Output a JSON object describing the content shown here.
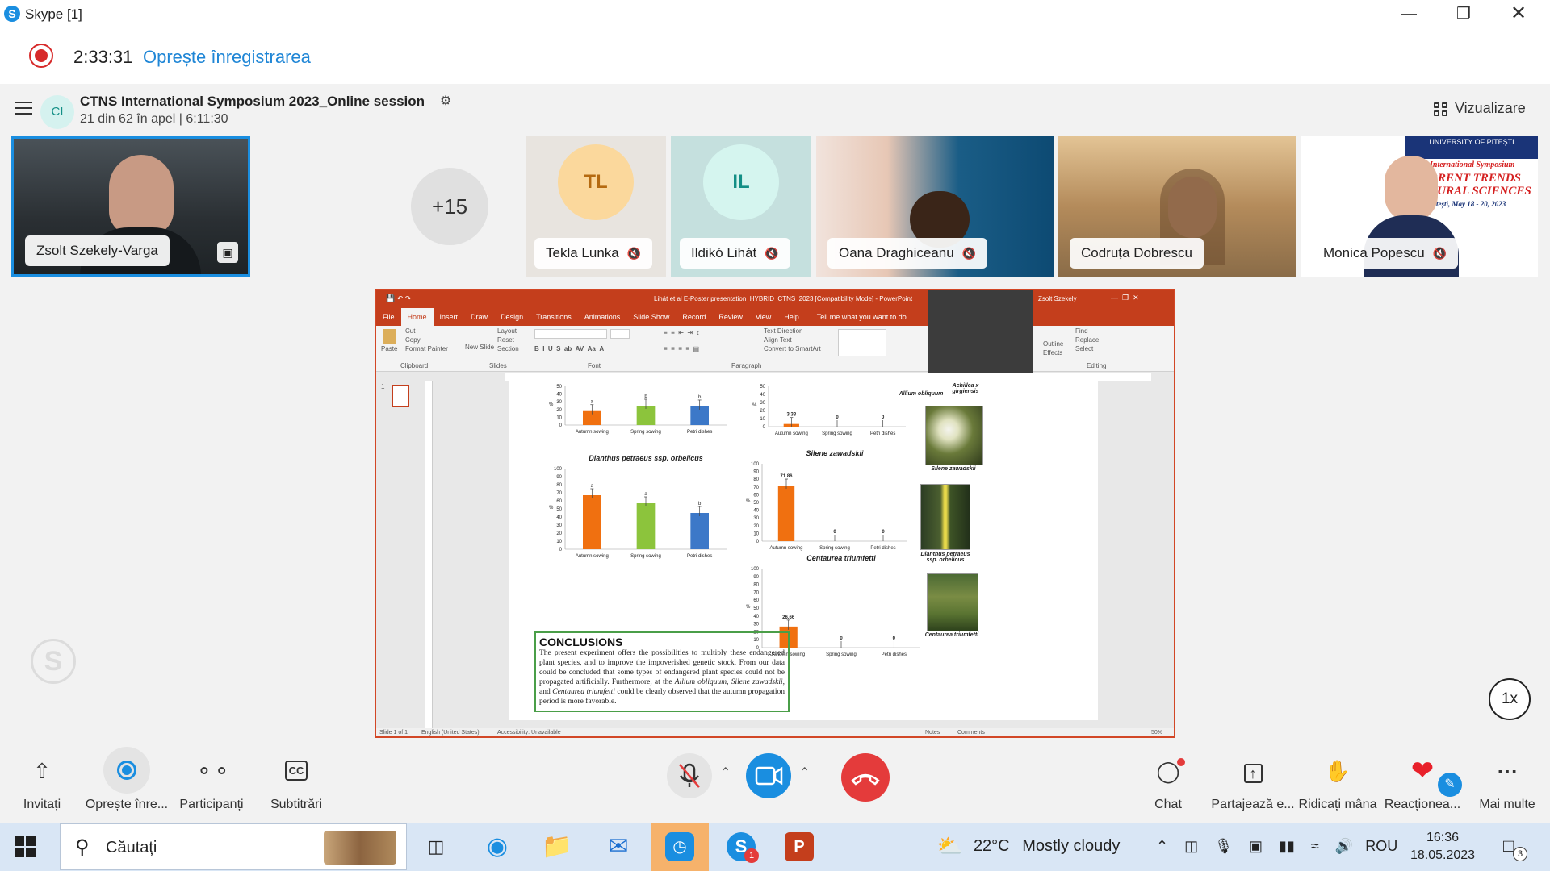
{
  "window": {
    "title": "Skype [1]"
  },
  "recording": {
    "time": "2:33:31",
    "stop_label": "Oprește înregistrarea"
  },
  "call": {
    "avatar_initials": "CI",
    "title": "CTNS International Symposium 2023_Online session",
    "subtitle": "21 din 62 în apel | 6:11:30",
    "view_label": "Vizualizare"
  },
  "participants": {
    "self_name": "Zsolt Szekely-Varga",
    "more_count": "+15",
    "tiles": [
      {
        "name": "Tekla Lunka",
        "initials": "TL"
      },
      {
        "name": "Ildikó Lihát",
        "initials": "IL"
      },
      {
        "name": "Oana Draghiceanu"
      },
      {
        "name": "Codruța Dobrescu"
      },
      {
        "name": "Monica Popescu"
      }
    ],
    "poster_text": [
      "UNIVERSITY OF PITEȘTI",
      "International Symposium",
      "RRENT TRENDS",
      "TURAL SCIENCES",
      "Pitești, May 18 - 20, 2023"
    ]
  },
  "ppt": {
    "titlebar": "Lihát et al E-Poster presentation_HYBRID_CTNS_2023 [Compatibility Mode] - PowerPoint",
    "user": "Zsolt Szekely",
    "tabs": [
      "File",
      "Home",
      "Insert",
      "Draw",
      "Design",
      "Transitions",
      "Animations",
      "Slide Show",
      "Record",
      "Review",
      "View",
      "Help",
      "Tell me what you want to do"
    ],
    "ribbon": {
      "paste": "Paste",
      "cut": "Cut",
      "copy": "Copy",
      "format_painter": "Format Painter",
      "clipboard": "Clipboard",
      "new_slide": "New Slide",
      "layout": "Layout",
      "reset": "Reset",
      "section": "Section",
      "slides": "Slides",
      "font": "Font",
      "paragraph": "Paragraph",
      "text_direction": "Text Direction",
      "align_text": "Align Text",
      "smartart": "Convert to SmartArt",
      "find": "Find",
      "replace": "Replace",
      "select": "Select",
      "editing": "Editing",
      "outline": "Outline",
      "effects": "Effects"
    },
    "status": {
      "slide": "Slide 1 of 1",
      "language": "English (United States)",
      "accessibility": "Accessibility: Unavailable",
      "notes": "Notes",
      "comments": "Comments",
      "zoom": "50%"
    },
    "slide_number": "1",
    "conclusions_title": "CONCLUSIONS",
    "conclusions_text_1": "The present experiment offers the possibilities to multiply these endangered plant species, and to improve the impoverished genetic stock. From our data could be concluded that some types of endangered plant species could not be propagated artificially. Furthermore, at the ",
    "conclusions_sp1": "Allium obliquum",
    "conclusions_sep1": ", ",
    "conclusions_sp2": "Silene zawadskii",
    "conclusions_sep2": ", and ",
    "conclusions_sp3": "Centaurea triumfetti",
    "conclusions_text_2": " could be clearly observed that the autumn propagation period is more favorable.",
    "photos": [
      {
        "caption": "Allium obliquum"
      },
      {
        "caption": "Achillea x girgiensis"
      },
      {
        "caption": "Silene zawadskii"
      },
      {
        "caption": "Dianthus petraeus ssp. orbelicus"
      },
      {
        "caption": "Centaurea triumfetti"
      }
    ]
  },
  "chart_data": [
    {
      "type": "bar",
      "title": "",
      "categories": [
        "Autumn sowing",
        "Spring sowing",
        "Petri dishes"
      ],
      "values": [
        18,
        25,
        24
      ],
      "letters": [
        "a",
        "b",
        "b"
      ],
      "ylabel": "%",
      "ylim": [
        0,
        50
      ],
      "colors": [
        "#f07010",
        "#8cc43c",
        "#3c78c8"
      ]
    },
    {
      "type": "bar",
      "title": "",
      "categories": [
        "Autumn sowing",
        "Spring sowing",
        "Petri dishes"
      ],
      "values": [
        3.33,
        0,
        0
      ],
      "data_labels": [
        "3.33",
        "0",
        "0"
      ],
      "ylabel": "%",
      "ylim": [
        0,
        50
      ],
      "colors": [
        "#f07010",
        "#8cc43c",
        "#3c78c8"
      ]
    },
    {
      "type": "bar",
      "title": "Dianthus petraeus ssp. orbelicus",
      "categories": [
        "Autumn sowing",
        "Spring sowing",
        "Petri dishes"
      ],
      "values": [
        67,
        57,
        45
      ],
      "letters": [
        "a",
        "a",
        "b"
      ],
      "ylabel": "%",
      "ylim": [
        0,
        100
      ],
      "colors": [
        "#f07010",
        "#8cc43c",
        "#3c78c8"
      ]
    },
    {
      "type": "bar",
      "title": "Silene zawadskii",
      "categories": [
        "Autumn sowing",
        "Spring sowing",
        "Petri dishes"
      ],
      "values": [
        71.86,
        0,
        0
      ],
      "data_labels": [
        "71.86",
        "0",
        "0"
      ],
      "ylabel": "%",
      "ylim": [
        0,
        100
      ],
      "colors": [
        "#f07010",
        "#8cc43c",
        "#3c78c8"
      ]
    },
    {
      "type": "bar",
      "title": "Centaurea triumfetti",
      "categories": [
        "Autumn sowing",
        "Spring sowing",
        "Petri dishes"
      ],
      "values": [
        26.66,
        0,
        0
      ],
      "data_labels": [
        "26.66",
        "0",
        "0"
      ],
      "ylabel": "%",
      "ylim": [
        0,
        100
      ],
      "colors": [
        "#f07010",
        "#8cc43c",
        "#3c78c8"
      ]
    }
  ],
  "playback": {
    "speed": "1x"
  },
  "controls": {
    "invite": "Invitați",
    "stop_rec": "Oprește înre...",
    "participants": "Participanți",
    "captions": "Subtitrări",
    "chat": "Chat",
    "share": "Partajează e...",
    "raise_hand": "Ridicați mâna",
    "react": "Reacționea...",
    "more": "Mai multe"
  },
  "taskbar": {
    "search": "Căutați",
    "temperature": "22°C",
    "weather": "Mostly cloudy",
    "language": "ROU",
    "time": "16:36",
    "date": "18.05.2023",
    "notif_count": "3",
    "skype_badge": "1"
  },
  "colors": {
    "accent": "#1a8ee0",
    "record": "#d72a2a",
    "hangup": "#e43b3b",
    "ppt": "#c43e1c"
  }
}
